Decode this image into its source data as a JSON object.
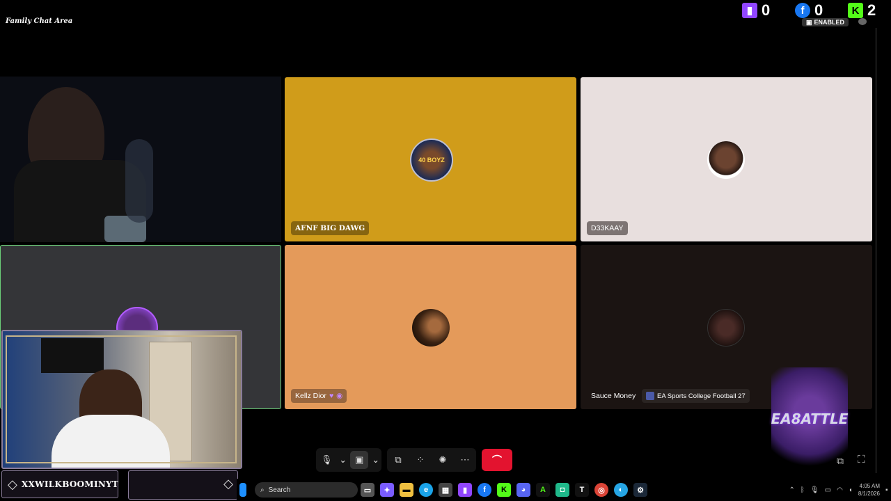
{
  "overlay": {
    "title": "Family Chat Area",
    "counters": [
      {
        "icon": "twitch-icon",
        "value": "0",
        "color": "#9146ff"
      },
      {
        "icon": "facebook-icon",
        "value": "0",
        "color": "#1877f2"
      },
      {
        "icon": "kick-icon",
        "value": "2",
        "color": "#53fc18"
      }
    ],
    "enabled_label": "ENABLED",
    "streamer_name": "XXWILKBOOMINYT",
    "logo_text": "EA8ATTLE"
  },
  "participants": [
    {
      "name": "AFNF BIG DAWG",
      "avatar_label": "40 BOYZ",
      "bg": "#d09c1a"
    },
    {
      "name": "D33KAAY",
      "bg": "#e8dfde"
    },
    {
      "name": "Kellz Dior",
      "bg": "#e49a5a"
    },
    {
      "name": "Sauce Money",
      "activity": "EA Sports College Football 27",
      "bg": "#1b1412"
    }
  ],
  "controls": {
    "leave_icon": "phone-hangup-icon"
  },
  "taskbar": {
    "search_placeholder": "Search",
    "time": "4:05 AM",
    "date": "8/1/2026"
  },
  "colors": {
    "accent_green": "#6cd17a",
    "hangup_red": "#e3132f"
  }
}
